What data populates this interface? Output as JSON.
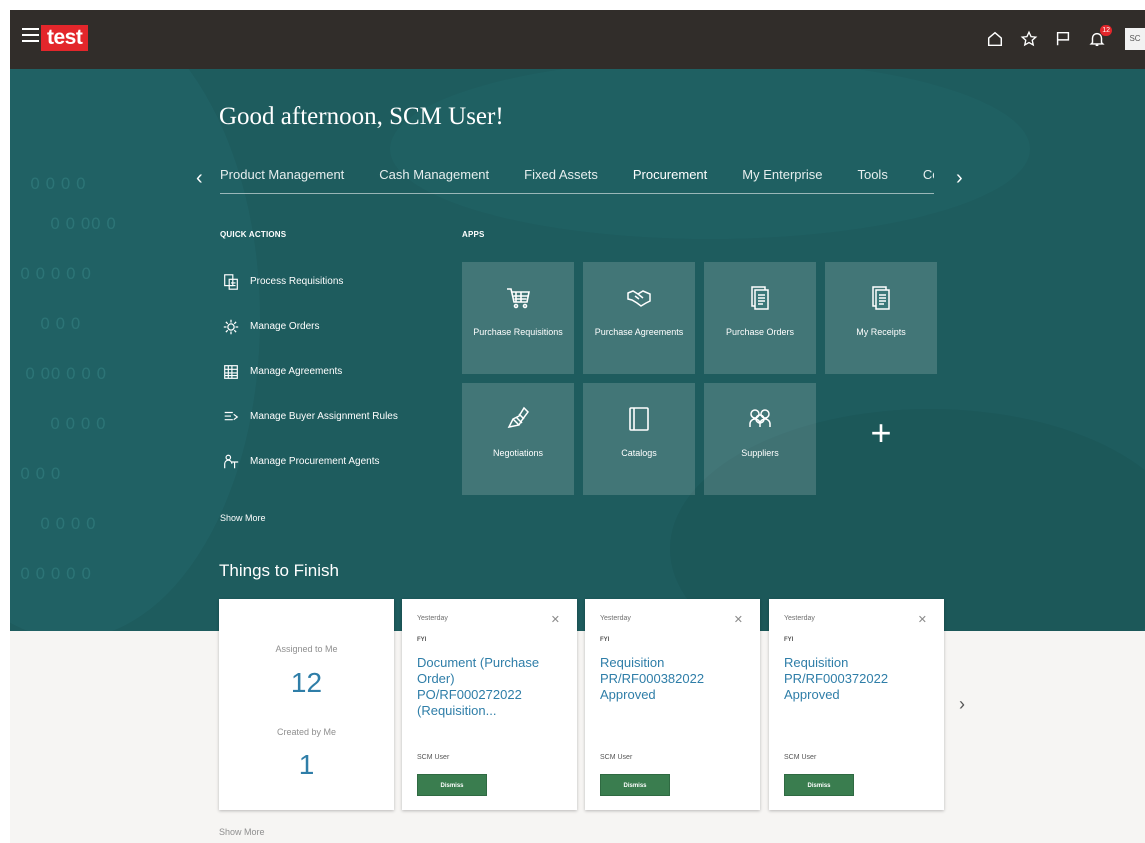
{
  "header": {
    "logo_text": "test",
    "notifications_count": "12",
    "avatar_initials": "SC",
    "icons": [
      "hamburger-icon",
      "home-icon",
      "star-icon",
      "flag-icon",
      "bell-icon"
    ]
  },
  "hero": {
    "greeting": "Good afternoon, SCM User!",
    "nav_tabs": [
      {
        "label": "Product Management",
        "active": false
      },
      {
        "label": "Cash Management",
        "active": false
      },
      {
        "label": "Fixed Assets",
        "active": false
      },
      {
        "label": "Procurement",
        "active": true
      },
      {
        "label": "My Enterprise",
        "active": false
      },
      {
        "label": "Tools",
        "active": false
      },
      {
        "label": "Cor",
        "active": false
      }
    ],
    "quick_actions_label": "QUICK ACTIONS",
    "apps_label": "APPS",
    "quick_actions": [
      {
        "label": "Process Requisitions",
        "icon": "requisition-icon"
      },
      {
        "label": "Manage Orders",
        "icon": "orders-gear-icon"
      },
      {
        "label": "Manage Agreements",
        "icon": "agreements-icon"
      },
      {
        "label": "Manage Buyer Assignment Rules",
        "icon": "rules-icon"
      },
      {
        "label": "Manage Procurement Agents",
        "icon": "agents-icon"
      }
    ],
    "show_more": "Show More",
    "apps": [
      {
        "label": "Purchase Requisitions",
        "icon": "cart-icon"
      },
      {
        "label": "Purchase Agreements",
        "icon": "handshake-icon"
      },
      {
        "label": "Purchase Orders",
        "icon": "documents-icon"
      },
      {
        "label": "My Receipts",
        "icon": "receipt-icon"
      },
      {
        "label": "Negotiations",
        "icon": "negotiation-icon"
      },
      {
        "label": "Catalogs",
        "icon": "catalog-icon"
      },
      {
        "label": "Suppliers",
        "icon": "suppliers-icon"
      }
    ],
    "things_to_finish": "Things to Finish"
  },
  "summary": {
    "assigned_label": "Assigned to Me",
    "assigned_count": "12",
    "created_label": "Created by Me",
    "created_count": "1"
  },
  "notifications": [
    {
      "time": "Yesterday",
      "tag": "FYI",
      "title": "Document (Purchase Order) PO/RF000272022 (Requisition...",
      "user": "SCM User",
      "button": "Dismiss"
    },
    {
      "time": "Yesterday",
      "tag": "FYI",
      "title": "Requisition PR/RF000382022 Approved",
      "user": "SCM User",
      "button": "Dismiss"
    },
    {
      "time": "Yesterday",
      "tag": "FYI",
      "title": "Requisition PR/RF000372022 Approved",
      "user": "SCM User",
      "button": "Dismiss"
    }
  ],
  "bottom_show_more": "Show More",
  "colors": {
    "hero_bg": "#1e5c5e",
    "topbar_bg": "#312d2a",
    "logo_bg": "#e3262b",
    "link_blue": "#2f7ea8",
    "dismiss_green": "#3a7d4f"
  }
}
